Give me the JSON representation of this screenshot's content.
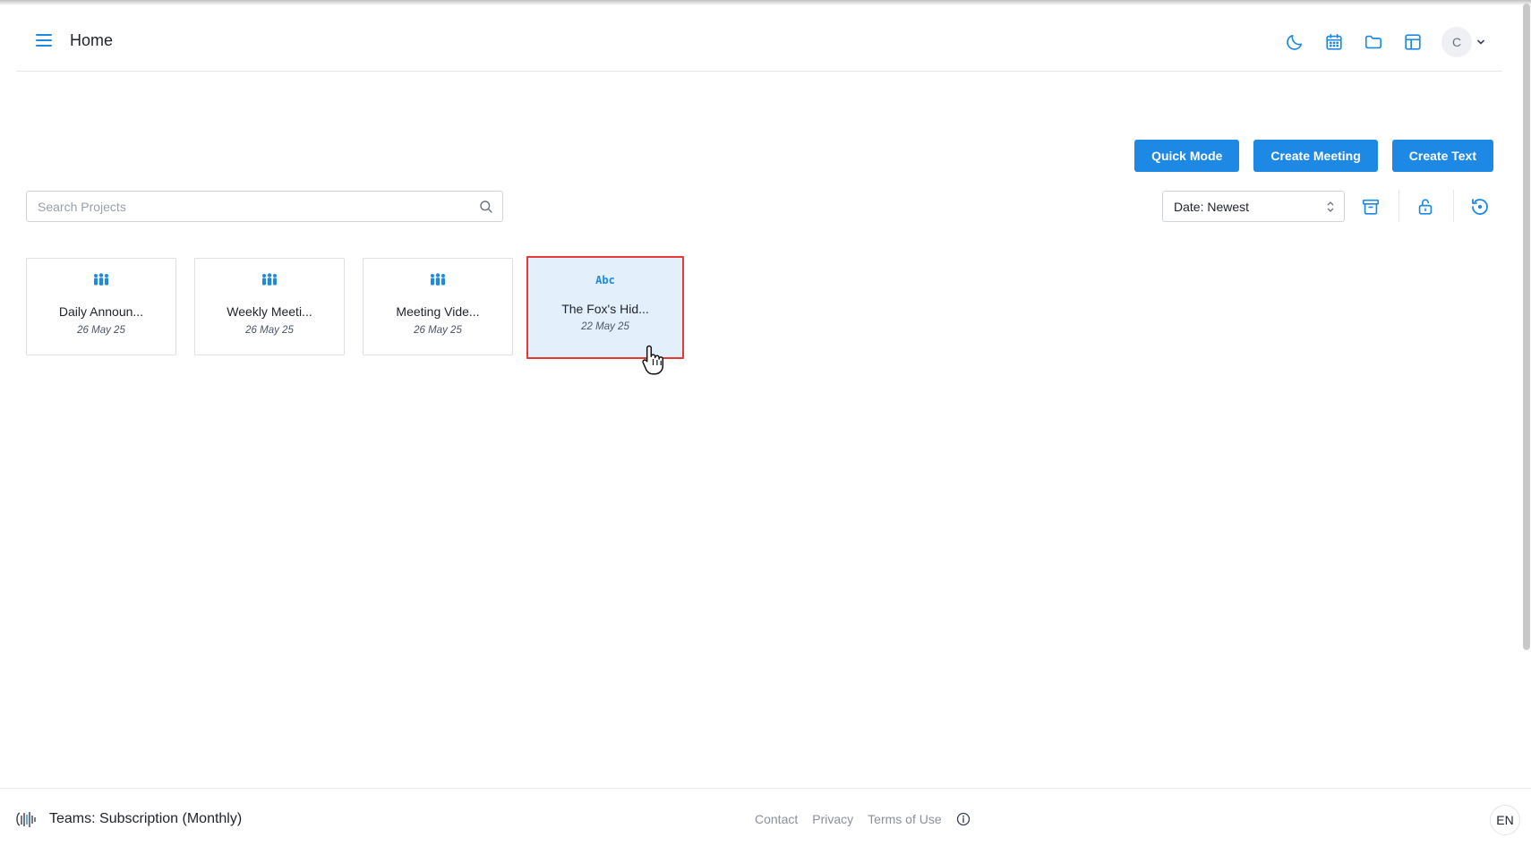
{
  "header": {
    "title": "Home",
    "icons": [
      "menu-icon",
      "moon-icon",
      "calendar-icon",
      "folder-icon",
      "table-icon"
    ],
    "avatar_initial": "C"
  },
  "actions": {
    "quick_mode": "Quick Mode",
    "create_meeting": "Create Meeting",
    "create_text": "Create Text"
  },
  "search": {
    "placeholder": "Search Projects",
    "value": ""
  },
  "sort": {
    "label": "Date: Newest"
  },
  "toolbar_icons": [
    "archive-icon",
    "unlock-icon",
    "history-icon"
  ],
  "projects": [
    {
      "name": "Daily Announ...",
      "date": "26 May 25",
      "icon": "people-icon"
    },
    {
      "name": "Weekly Meeti...",
      "date": "26 May 25",
      "icon": "people-icon"
    },
    {
      "name": "Meeting Vide...",
      "date": "26 May 25",
      "icon": "people-icon"
    },
    {
      "name": "The Fox's Hid...",
      "date": "22 May 25",
      "icon": "text-abc-icon",
      "icon_text": "Abc",
      "selected": true
    }
  ],
  "footer": {
    "plan": "Teams: Subscription (Monthly)",
    "links": {
      "contact": "Contact",
      "privacy": "Privacy",
      "terms": "Terms of Use"
    },
    "language": "EN"
  },
  "colors": {
    "primary": "#1e88e5",
    "selected_bg": "#e3f0fb",
    "selected_border": "#e53935"
  }
}
